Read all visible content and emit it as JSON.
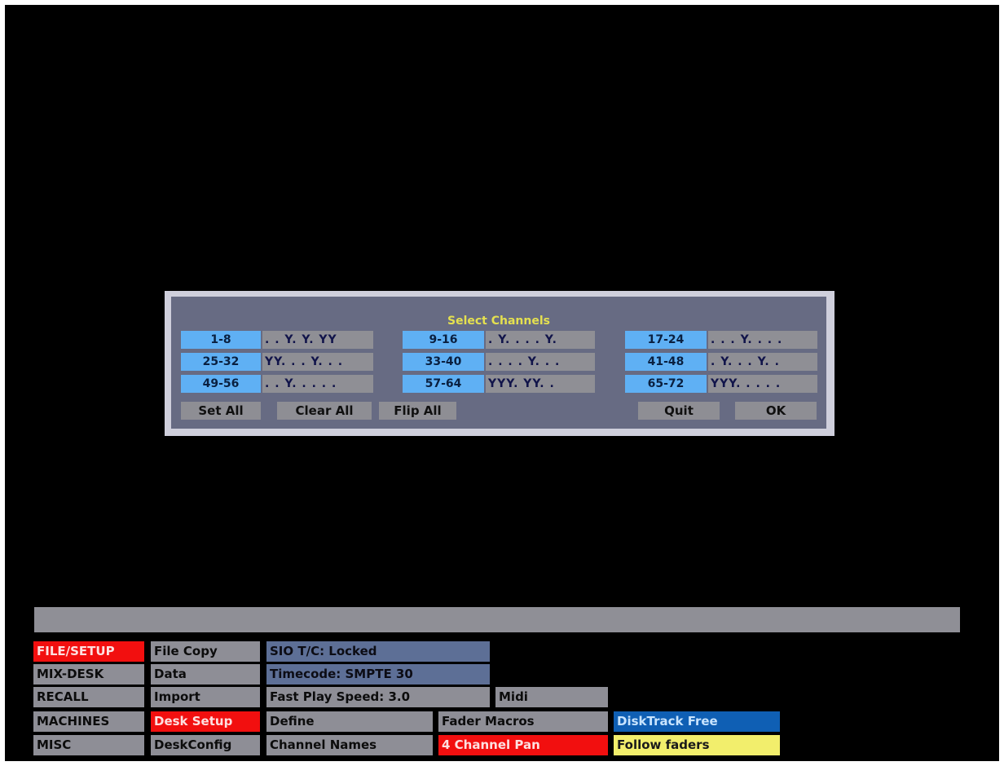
{
  "dialog": {
    "title": "Select Channels",
    "groups": [
      {
        "range": "1-8",
        "value": ". . Y. Y. YY"
      },
      {
        "range": "9-16",
        "value": ". Y. . . . Y."
      },
      {
        "range": "17-24",
        "value": ". . . Y. . . ."
      },
      {
        "range": "25-32",
        "value": "YY. . . Y. . ."
      },
      {
        "range": "33-40",
        "value": ". . . . Y. . ."
      },
      {
        "range": "41-48",
        "value": ". Y. . . Y. ."
      },
      {
        "range": "49-56",
        "value": ". . Y. . . . ."
      },
      {
        "range": "57-64",
        "value": "YYY. YY. ."
      },
      {
        "range": "65-72",
        "value": "YYY. . . . ."
      }
    ],
    "buttons": {
      "set_all": "Set All",
      "clear_all": "Clear All",
      "flip_all": "Flip All",
      "quit": "Quit",
      "ok": "OK"
    }
  },
  "menu": {
    "col1": [
      "FILE/SETUP",
      "MIX-DESK",
      "RECALL",
      "MACHINES",
      "MISC"
    ],
    "col2": [
      "File Copy",
      "Data",
      "Import",
      "Desk Setup",
      "DeskConfig"
    ],
    "sio_tc": "SIO T/C: Locked",
    "timecode": "Timecode: SMPTE 30",
    "fast_play": "Fast Play Speed: 3.0",
    "midi": "Midi",
    "define": "Define",
    "fader_macros": "Fader Macros",
    "disktrack": "DiskTrack Free",
    "channel_names": "Channel Names",
    "channel_pan": "4 Channel Pan",
    "follow_faders": "Follow faders"
  },
  "colors": {
    "background": "#000000",
    "selected": "#f20f0f",
    "range_label": "#5fb0f4",
    "title": "#e4e050"
  }
}
